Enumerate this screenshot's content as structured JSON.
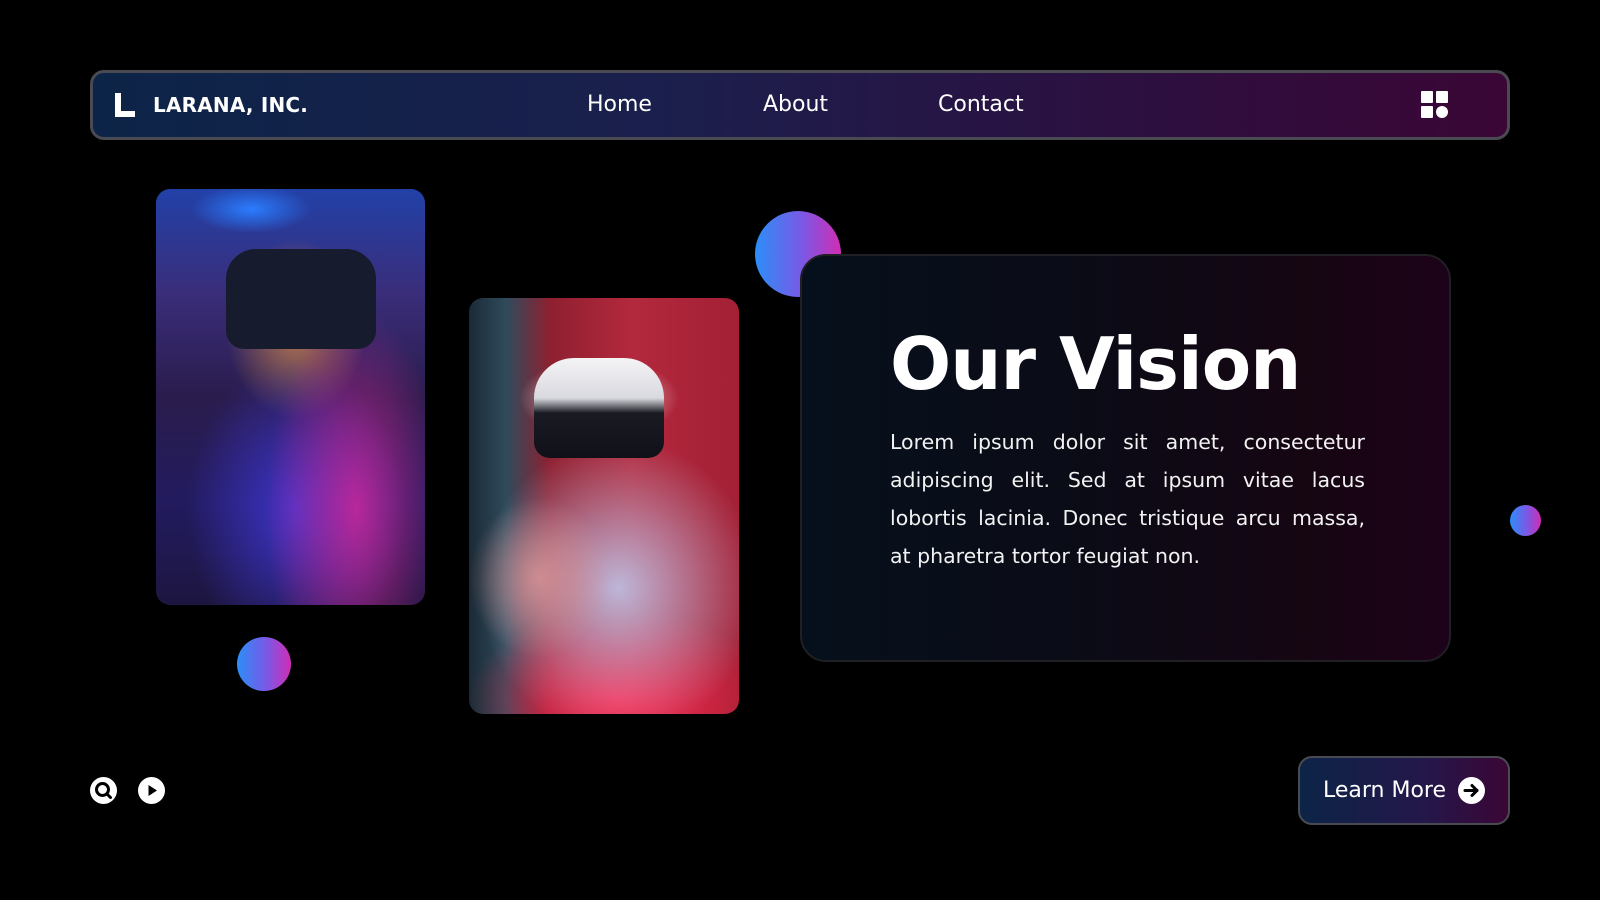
{
  "header": {
    "brand_name": "LARANA, INC.",
    "nav": [
      {
        "label": "Home"
      },
      {
        "label": "About"
      },
      {
        "label": "Contact"
      }
    ],
    "menu_icon": "grid-icon"
  },
  "hero": {
    "title": "Our Vision",
    "body": "Lorem ipsum dolor sit amet, consectetur adipiscing elit. Sed at ipsum vitae lacus lobortis lacinia. Donec tristique arcu massa, at pharetra tortor feugiat non."
  },
  "images": [
    {
      "name": "woman-with-vr-headset-photo"
    },
    {
      "name": "man-with-vr-headset-and-controllers-photo"
    }
  ],
  "footer": {
    "icons": [
      "search-icon",
      "play-icon"
    ],
    "cta_label": "Learn More",
    "cta_icon": "arrow-right-circle-icon"
  },
  "colors": {
    "background": "#000000",
    "gradient_start": "#0c2447",
    "gradient_end": "#3a0635",
    "orb_start": "#2c8ef8",
    "orb_end": "#d02db4",
    "text": "#ffffff"
  }
}
